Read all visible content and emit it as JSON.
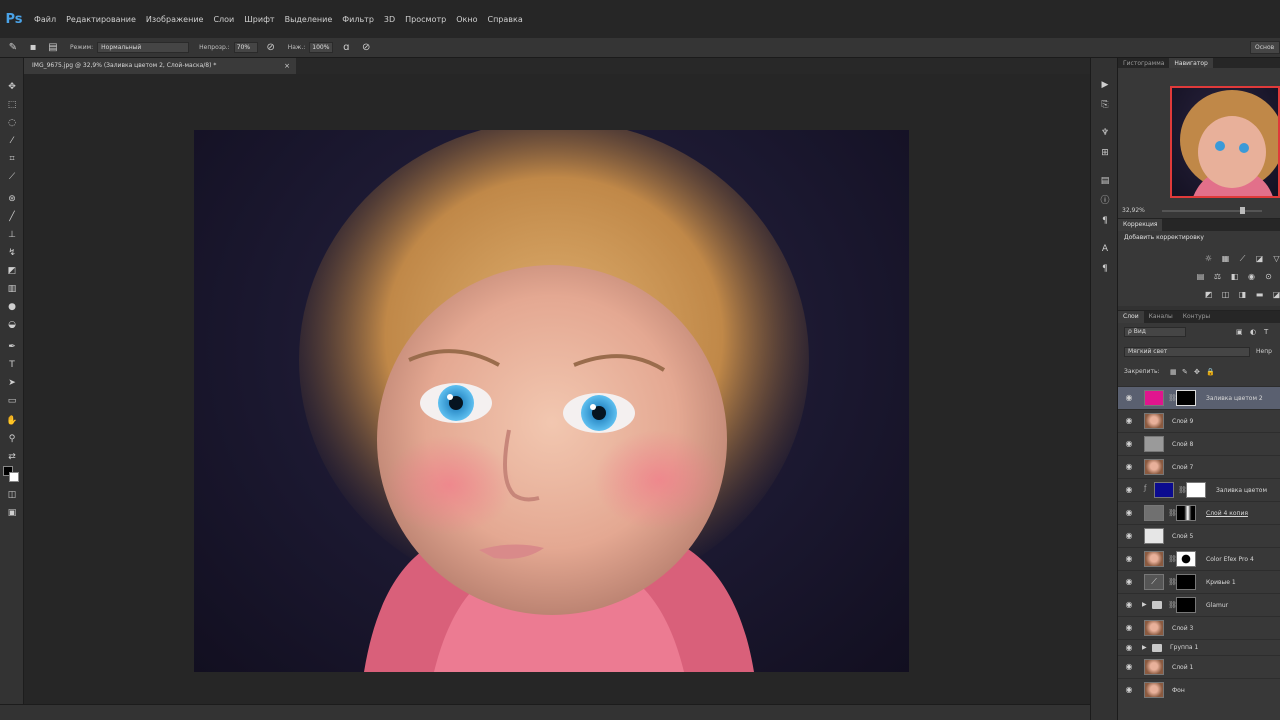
{
  "app": {
    "logo": "Ps"
  },
  "menu": [
    "Файл",
    "Редактирование",
    "Изображение",
    "Слои",
    "Шрифт",
    "Выделение",
    "Фильтр",
    "3D",
    "Просмотр",
    "Окно",
    "Справка"
  ],
  "options": {
    "mode_label": "Режим:",
    "mode_value": "Нормальный",
    "opacity_label": "Непрозр.:",
    "opacity_value": "70%",
    "flow_label": "Наж.:",
    "flow_value": "100%",
    "right_button": "Основ"
  },
  "document": {
    "tab_title": "IMG_9675.jpg @ 32,9% (Заливка цветом 2, Слой-маска/8) *",
    "close": "×"
  },
  "panels": {
    "top_tabs": [
      "Гистограмма",
      "Навигатор"
    ],
    "zoom": "32,92%",
    "adjustments_tab": "Коррекция",
    "adjustments_title": "Добавить корректировку",
    "layers_tabs": [
      "Слои",
      "Каналы",
      "Контуры"
    ],
    "filter_value": "ρ Вид",
    "blend_value": "Мягкий свет",
    "opacity_cut": "Непр",
    "lock_label": "Закрепить:"
  },
  "layers": [
    {
      "name": "Заливка цветом 2",
      "thumb": "#e0158e",
      "mask": "black-white",
      "selected": true
    },
    {
      "name": "Слой 9",
      "thumb": "face"
    },
    {
      "name": "Слой 8",
      "thumb": "#9a9a9a"
    },
    {
      "name": "Слой 7",
      "thumb": "face"
    },
    {
      "name": "Заливка цветом",
      "thumb": "#0b0b8f",
      "mask": "white",
      "fx": "ƒ"
    },
    {
      "name": "Слой 4 копия",
      "thumb": "#707070",
      "mask": "black-white",
      "underline": true
    },
    {
      "name": "Слой 5",
      "thumb": "#e6e6e6"
    },
    {
      "name": "Color Efex Pro 4",
      "thumb": "face",
      "mask": "white-dot"
    },
    {
      "name": "Кривые 1",
      "thumb": "curves",
      "mask": "black"
    },
    {
      "name": "Glamur",
      "folder": true,
      "mask": "black"
    },
    {
      "name": "Слой 3",
      "thumb": "face"
    },
    {
      "name": "Группа 1",
      "folder": true,
      "short": true
    },
    {
      "name": "Слой 1",
      "thumb": "face"
    },
    {
      "name": "Фон",
      "thumb": "face"
    }
  ],
  "icons": {
    "tools": [
      "move-icon",
      "marquee-icon",
      "lasso-icon",
      "quick-select-icon",
      "crop-icon",
      "eyedropper-icon",
      "healing-icon",
      "brush-icon",
      "clone-stamp-icon",
      "history-brush-icon",
      "eraser-icon",
      "gradient-icon",
      "blur-icon",
      "dodge-icon",
      "pen-icon",
      "type-icon",
      "path-select-icon",
      "shape-icon",
      "hand-icon",
      "zoom-icon"
    ]
  },
  "colors": {
    "selected_layer": "#5a6070",
    "navigator_frame": "#e03a3a"
  }
}
